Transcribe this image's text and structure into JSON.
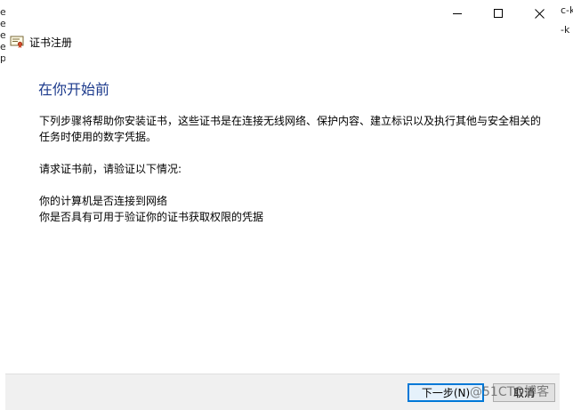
{
  "background_fragments": {
    "left": [
      "e",
      "e",
      "e",
      "e",
      "p"
    ],
    "right": [
      "c-k",
      "-k"
    ]
  },
  "window": {
    "title": "证书注册",
    "icons": {
      "title": "certificate-icon",
      "minimize": "minimize-icon",
      "maximize": "maximize-icon",
      "close": "close-icon"
    }
  },
  "main": {
    "heading": "在你开始前",
    "paragraph1_line1": "下列步骤将帮助你安装证书，这些证书是在连接无线网络、保护内容、建立标识以及执行其他与安全相关的",
    "paragraph1_line2": "任务时使用的数字凭据。",
    "paragraph2": "请求证书前，请验证以下情况:",
    "condition1": "你的计算机是否连接到网络",
    "condition2": "你是否具有可用于验证你的证书获取权限的凭据"
  },
  "footer": {
    "next_label": "下一步(N)",
    "cancel_label": "取消"
  },
  "watermark": "@51CTO博客",
  "colors": {
    "heading": "#1c3a8c",
    "accent": "#0078d7",
    "footer_bg": "#f0f0f0"
  }
}
